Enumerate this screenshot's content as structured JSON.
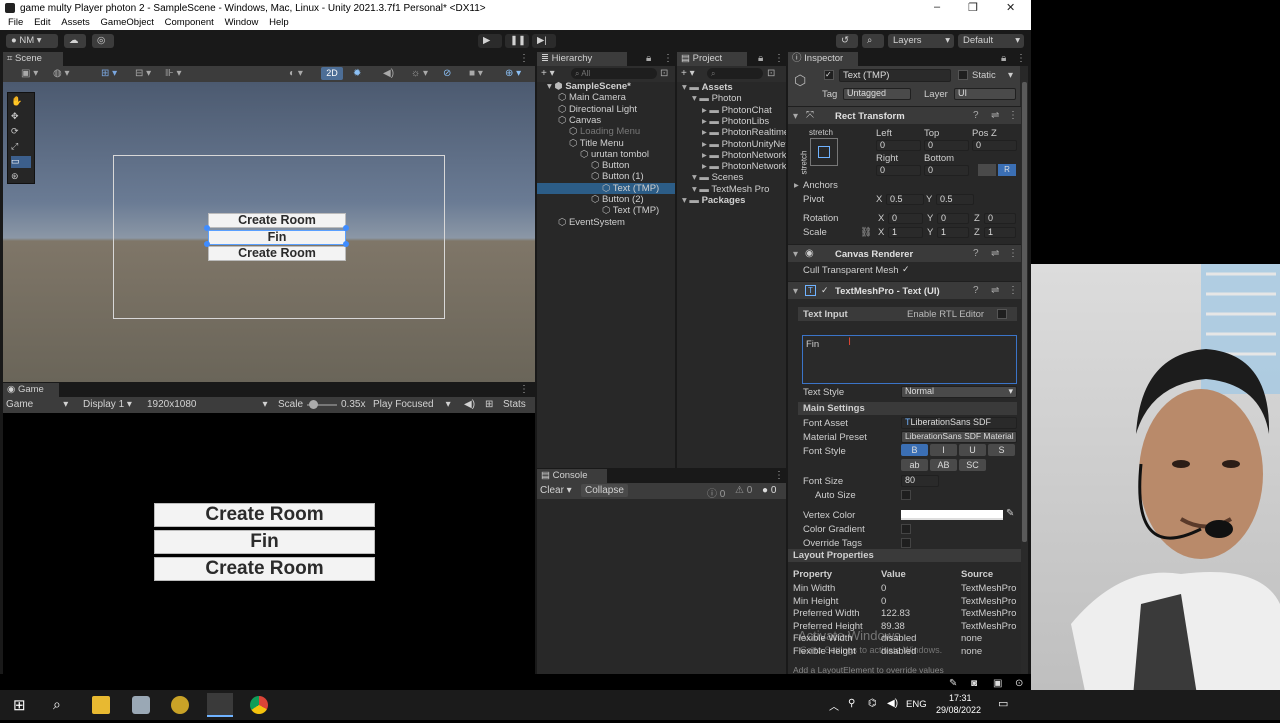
{
  "window": {
    "title": "game multy Player photon 2 - SampleScene - Windows, Mac, Linux - Unity 2021.3.7f1 Personal* <DX11>",
    "minimize": "–",
    "maximize": "❐",
    "close": "✕"
  },
  "menu": [
    "File",
    "Edit",
    "Assets",
    "GameObject",
    "Component",
    "Window",
    "Help"
  ],
  "toolbar": {
    "account": "NM",
    "layers": "Layers",
    "layout": "Default"
  },
  "scene": {
    "tab": "Scene",
    "mode2d": "2D",
    "buttons": [
      "Create Room",
      "Fin",
      "Create Room"
    ]
  },
  "game": {
    "tab": "Game",
    "display_type": "Game",
    "display": "Display 1",
    "resolution": "1920x1080",
    "scale_label": "Scale",
    "scale_value": "0.35x",
    "play_mode": "Play Focused",
    "stats": "Stats",
    "buttons": [
      "Create Room",
      "Fin",
      "Create Room"
    ]
  },
  "hierarchy": {
    "tab": "Hierarchy",
    "search": "All",
    "items": [
      {
        "label": "SampleScene*",
        "depth": 0,
        "bold": true
      },
      {
        "label": "Main Camera",
        "depth": 1
      },
      {
        "label": "Directional Light",
        "depth": 1
      },
      {
        "label": "Canvas",
        "depth": 1
      },
      {
        "label": "Loading Menu",
        "depth": 2,
        "dim": true
      },
      {
        "label": "Title Menu",
        "depth": 2
      },
      {
        "label": "urutan tombol",
        "depth": 3
      },
      {
        "label": "Button",
        "depth": 4
      },
      {
        "label": "Button (1)",
        "depth": 4
      },
      {
        "label": "Text (TMP)",
        "depth": 5,
        "selected": true
      },
      {
        "label": "Button (2)",
        "depth": 4
      },
      {
        "label": "Text (TMP)",
        "depth": 5
      },
      {
        "label": "EventSystem",
        "depth": 1
      }
    ]
  },
  "project": {
    "tab": "Project",
    "items": [
      {
        "label": "Assets",
        "depth": 0,
        "bold": true
      },
      {
        "label": "Photon",
        "depth": 1
      },
      {
        "label": "PhotonChat",
        "depth": 2
      },
      {
        "label": "PhotonLibs",
        "depth": 2
      },
      {
        "label": "PhotonRealtime",
        "depth": 2
      },
      {
        "label": "PhotonUnityNetworking",
        "depth": 2
      },
      {
        "label": "PhotonNetworking-Documentation",
        "depth": 2
      },
      {
        "label": "PhotonNetworking-Documentation",
        "depth": 2
      },
      {
        "label": "Scenes",
        "depth": 1
      },
      {
        "label": "TextMesh Pro",
        "depth": 1
      },
      {
        "label": "Packages",
        "depth": 0,
        "bold": true
      }
    ]
  },
  "console": {
    "tab": "Console",
    "clear": "Clear",
    "collapse": "Collapse",
    "c1": "0",
    "c2": "0",
    "c3": "0"
  },
  "inspector": {
    "tab": "Inspector",
    "object_name": "Text (TMP)",
    "static": "Static",
    "tag_label": "Tag",
    "tag": "Untagged",
    "layer_label": "Layer",
    "layer": "UI",
    "rect": {
      "title": "Rect Transform",
      "stretch": "stretch",
      "stretch_v": "stretch",
      "left_l": "Left",
      "top_l": "Top",
      "posz_l": "Pos Z",
      "left": "0",
      "top": "0",
      "posz": "0",
      "right_l": "Right",
      "bottom_l": "Bottom",
      "right": "0",
      "bottom": "0",
      "r_btn": "R",
      "anchors": "Anchors",
      "pivot": "Pivot",
      "px_l": "X",
      "px": "0.5",
      "py_l": "Y",
      "py": "0.5",
      "rotation": "Rotation",
      "rx": "0",
      "ry": "0",
      "rz": "0",
      "scale": "Scale",
      "sx": "1",
      "sy": "1",
      "sz": "1",
      "x": "X",
      "y": "Y",
      "z": "Z"
    },
    "canvas_renderer": {
      "title": "Canvas Renderer",
      "cull": "Cull Transparent Mesh"
    },
    "tmp": {
      "title": "TextMeshPro - Text (UI)",
      "text_input": "Text Input",
      "rtl": "Enable RTL Editor",
      "text": "Fin",
      "text_style_l": "Text Style",
      "text_style": "Normal",
      "main_settings": "Main Settings",
      "font_asset_l": "Font Asset",
      "font_asset": "LiberationSans SDF",
      "material_l": "Material Preset",
      "material": "LiberationSans SDF Material",
      "font_style_l": "Font Style",
      "fs": [
        "B",
        "I",
        "U",
        "S"
      ],
      "fs2": [
        "ab",
        "AB",
        "SC"
      ],
      "font_size_l": "Font Size",
      "font_size": "80",
      "auto_size": "Auto Size",
      "vertex_color": "Vertex Color",
      "color_gradient": "Color Gradient",
      "override_tags": "Override Tags"
    },
    "layout": {
      "title": "Layout Properties",
      "headers": [
        "Property",
        "Value",
        "Source"
      ],
      "rows": [
        [
          "Min Width",
          "0",
          "TextMeshPro"
        ],
        [
          "Min Height",
          "0",
          "TextMeshPro"
        ],
        [
          "Preferred Width",
          "122.83",
          "TextMeshPro"
        ],
        [
          "Preferred Height",
          "89.38",
          "TextMeshPro"
        ],
        [
          "Flexible Width",
          "disabled",
          "none"
        ],
        [
          "Flexible Height",
          "disabled",
          "none"
        ]
      ],
      "footer": "Add a LayoutElement to override values"
    },
    "activate": "Activate Windows",
    "activate_sub": "Go to Settings to activate Windows."
  },
  "taskbar": {
    "lang": "ENG",
    "time": "17:31",
    "date": "29/08/2022"
  },
  "colors": {
    "accent": "#3b6fb4",
    "selected_row": "#2c5d87",
    "unity_bg": "#191919",
    "panel": "#282828"
  }
}
